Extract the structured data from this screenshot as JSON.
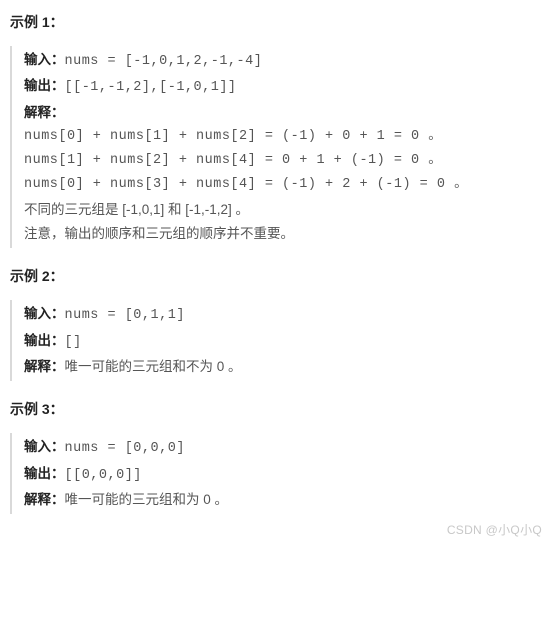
{
  "labels": {
    "input": "输入：",
    "output": "输出：",
    "explain": "解释："
  },
  "ex1": {
    "title": "示例 1：",
    "input_code": "nums = [-1,0,1,2,-1,-4]",
    "output_code": "[[-1,-1,2],[-1,0,1]]",
    "explain_lines": [
      "nums[0] + nums[1] + nums[2] = (-1) + 0 + 1 = 0 。",
      "nums[1] + nums[2] + nums[4] = 0 + 1 + (-1) = 0 。",
      "nums[0] + nums[3] + nums[4] = (-1) + 2 + (-1) = 0 。"
    ],
    "explain_tail1": "不同的三元组是 [-1,0,1] 和 [-1,-1,2] 。",
    "explain_tail2": "注意，输出的顺序和三元组的顺序并不重要。"
  },
  "ex2": {
    "title": "示例 2：",
    "input_code": "nums = [0,1,1]",
    "output_code": "[]",
    "explain_text": "唯一可能的三元组和不为 0 。"
  },
  "ex3": {
    "title": "示例 3：",
    "input_code": "nums = [0,0,0]",
    "output_code": "[[0,0,0]]",
    "explain_text": "唯一可能的三元组和为 0 。"
  },
  "watermark": "CSDN @小Q小Q"
}
